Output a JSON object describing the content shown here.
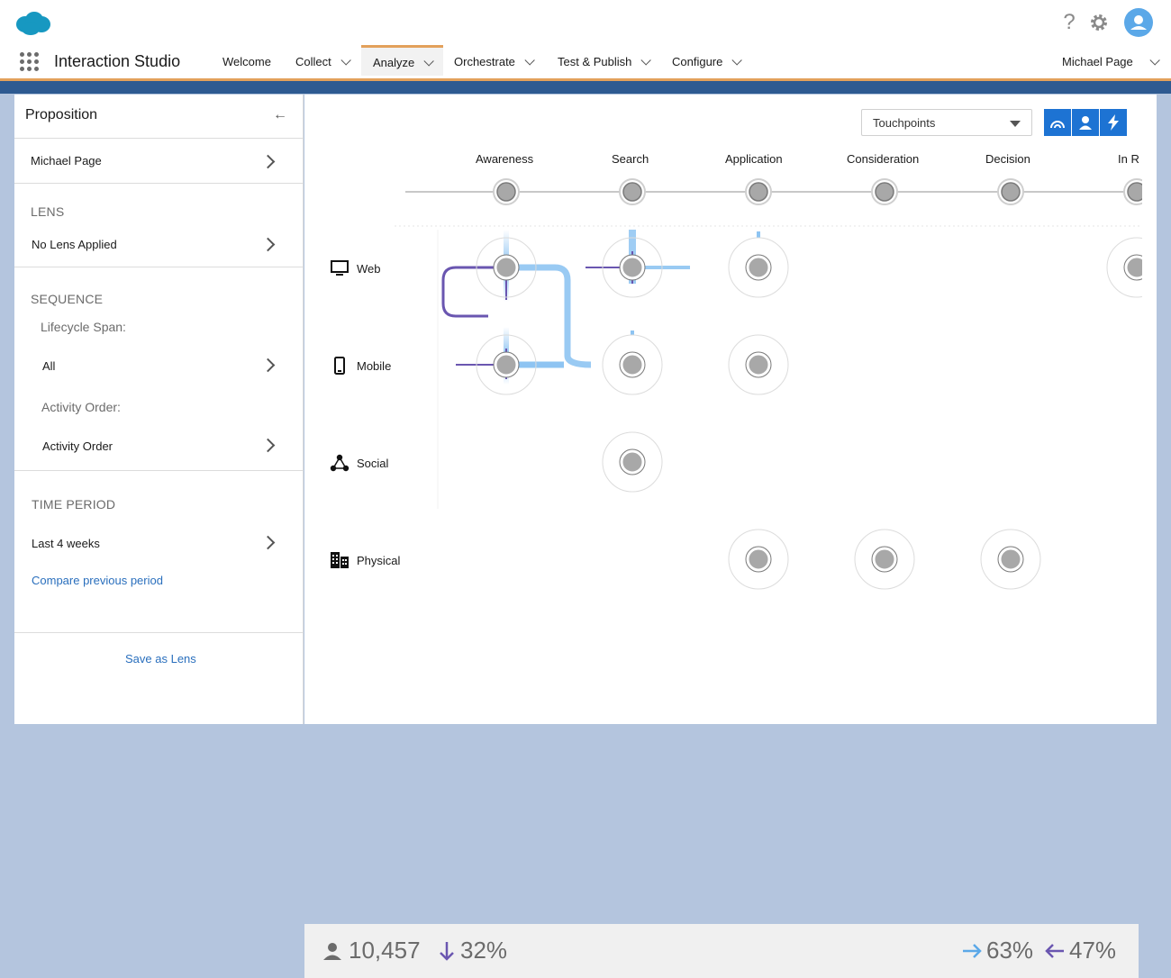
{
  "app": {
    "title": "Interaction Studio"
  },
  "nav": {
    "items": [
      {
        "label": "Welcome"
      },
      {
        "label": "Collect"
      },
      {
        "label": "Analyze"
      },
      {
        "label": "Orchestrate"
      },
      {
        "label": "Test & Publish"
      },
      {
        "label": "Configure"
      }
    ],
    "user": "Michael Page"
  },
  "panel": {
    "title": "Proposition",
    "proposition_value": "Michael Page",
    "lens_label": "LENS",
    "lens_value": "No Lens Applied",
    "sequence_label": "SEQUENCE",
    "lifecycle_label": "Lifecycle Span:",
    "lifecycle_value": "All",
    "activity_label": "Activity Order:",
    "activity_value": "Activity Order",
    "time_label": "TIME PERIOD",
    "time_value": "Last 4 weeks",
    "compare_link": "Compare previous period",
    "save_link": "Save as Lens"
  },
  "main": {
    "view_select": "Touchpoints",
    "stages": [
      "Awareness",
      "Search",
      "Application",
      "Consideration",
      "Decision",
      "In R"
    ],
    "channels": [
      "Web",
      "Mobile",
      "Social",
      "Physical"
    ]
  },
  "footer": {
    "users": "10,457",
    "drop": "32%",
    "forward": "63%",
    "backward": "47%"
  },
  "colors": {
    "accent": "#1d73d3",
    "nav_active": "#e3a15b",
    "flow_blue": "#8ec4f2",
    "flow_purple": "#6a56b0"
  }
}
